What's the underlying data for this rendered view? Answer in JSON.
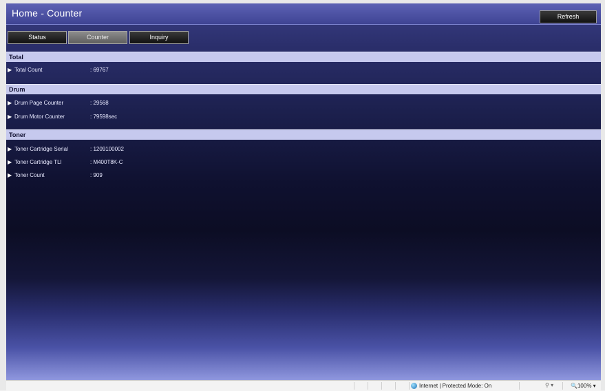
{
  "header": {
    "title": "Home - Counter",
    "refresh_label": "Refresh"
  },
  "tabs": [
    {
      "label": "Status",
      "active": false
    },
    {
      "label": "Counter",
      "active": true
    },
    {
      "label": "Inquiry",
      "active": false
    }
  ],
  "sections": {
    "total": {
      "title": "Total",
      "rows": [
        {
          "label": "Total Count",
          "value": ": 69767"
        }
      ]
    },
    "drum": {
      "title": "Drum",
      "rows": [
        {
          "label": "Drum Page Counter",
          "value": ": 29568"
        },
        {
          "label": "Drum Motor Counter",
          "value": ": 79598sec"
        }
      ]
    },
    "toner": {
      "title": "Toner",
      "rows": [
        {
          "label": "Toner Cartridge Serial",
          "value": ": 1209100002"
        },
        {
          "label": "Toner Cartridge TLI",
          "value": ": M400T8K-C"
        },
        {
          "label": "Toner Count",
          "value": ": 909"
        }
      ]
    }
  },
  "statusbar": {
    "zone": "Internet | Protected Mode: On",
    "zoom": "100%"
  },
  "colors": {
    "section_header_bg": "#c6c9ee",
    "title_bar": "#4f54a6",
    "active_tab": "#7a7a7a"
  }
}
